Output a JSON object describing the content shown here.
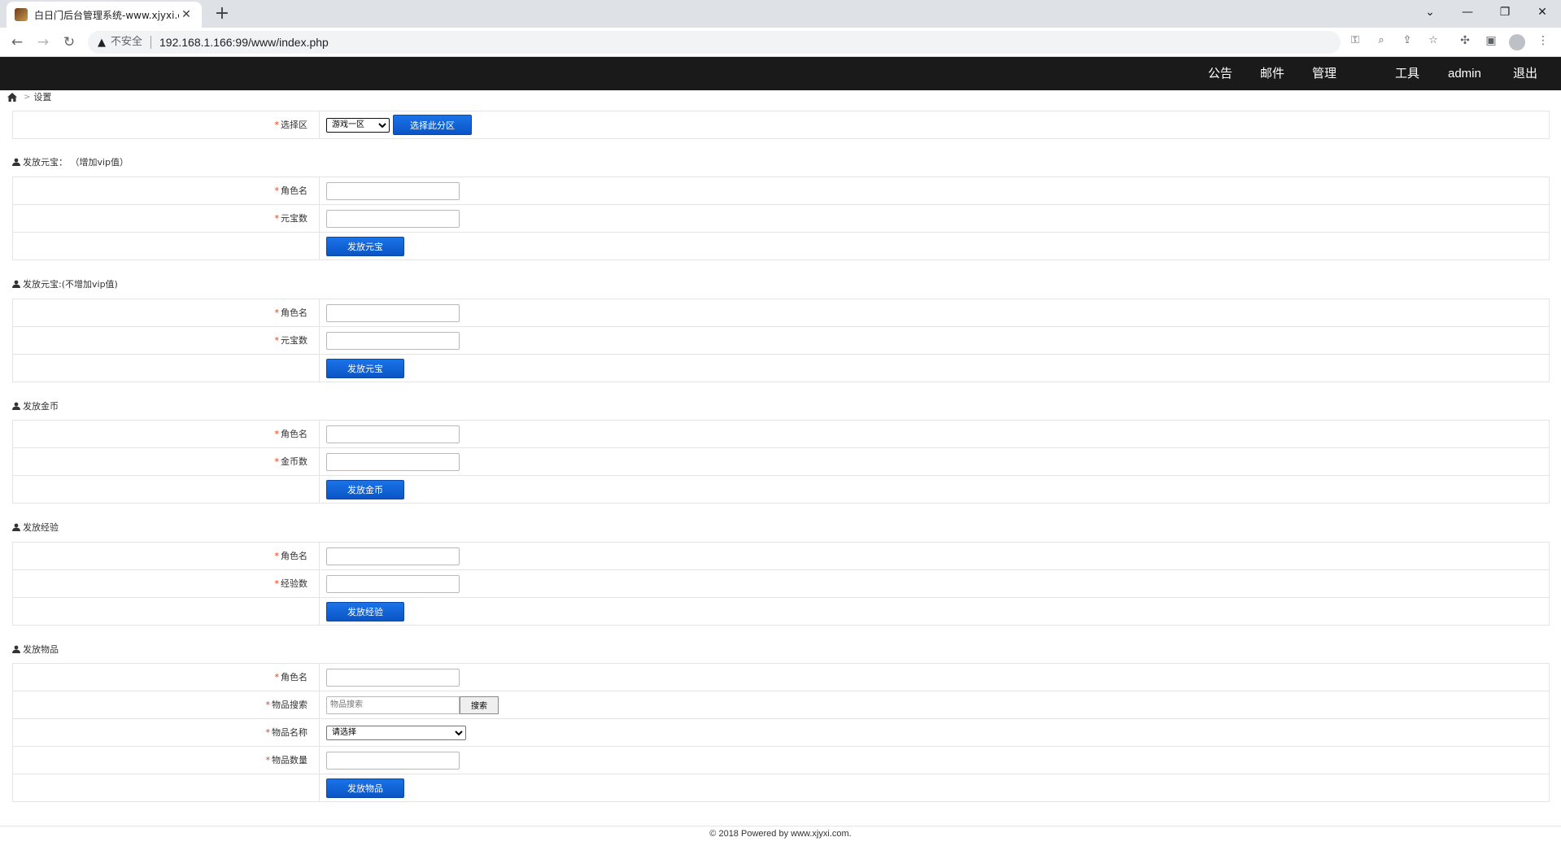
{
  "browser": {
    "tab_title": "白日门后台管理系统-www.xjyxi.com",
    "tab_close": "✕",
    "new_tab": "+",
    "window_controls": [
      "⌄",
      "—",
      "❐",
      "✕"
    ],
    "security_label": "不安全",
    "url": "192.168.1.166:99/www/index.php"
  },
  "topnav": {
    "items": [
      "公告",
      "邮件",
      "管理",
      "工具",
      "admin",
      "退出"
    ]
  },
  "breadcrumb": {
    "current": "设置",
    "separator": ">"
  },
  "zone": {
    "label": "选择区",
    "selected": "游戏一区",
    "button": "选择此分区"
  },
  "sections": [
    {
      "title": "发放元宝： （增加vip值）",
      "fields": [
        {
          "label": "角色名"
        },
        {
          "label": "元宝数"
        }
      ],
      "button": "发放元宝"
    },
    {
      "title": "发放元宝:(不增加vip值)",
      "fields": [
        {
          "label": "角色名"
        },
        {
          "label": "元宝数"
        }
      ],
      "button": "发放元宝"
    },
    {
      "title": "发放金币",
      "fields": [
        {
          "label": "角色名"
        },
        {
          "label": "金币数"
        }
      ],
      "button": "发放金币"
    },
    {
      "title": "发放经验",
      "fields": [
        {
          "label": "角色名"
        },
        {
          "label": "经验数"
        }
      ],
      "button": "发放经验"
    },
    {
      "title": "发放物品",
      "fields": [
        {
          "label": "角色名"
        },
        {
          "label": "物品搜索",
          "placeholder": "物品搜索",
          "button": "搜索"
        },
        {
          "label": "物品名称",
          "selected": "请选择"
        },
        {
          "label": "物品数量"
        }
      ],
      "button": "发放物品"
    }
  ],
  "required_mark": "*",
  "footer": "© 2018 Powered by www.xjyxi.com."
}
